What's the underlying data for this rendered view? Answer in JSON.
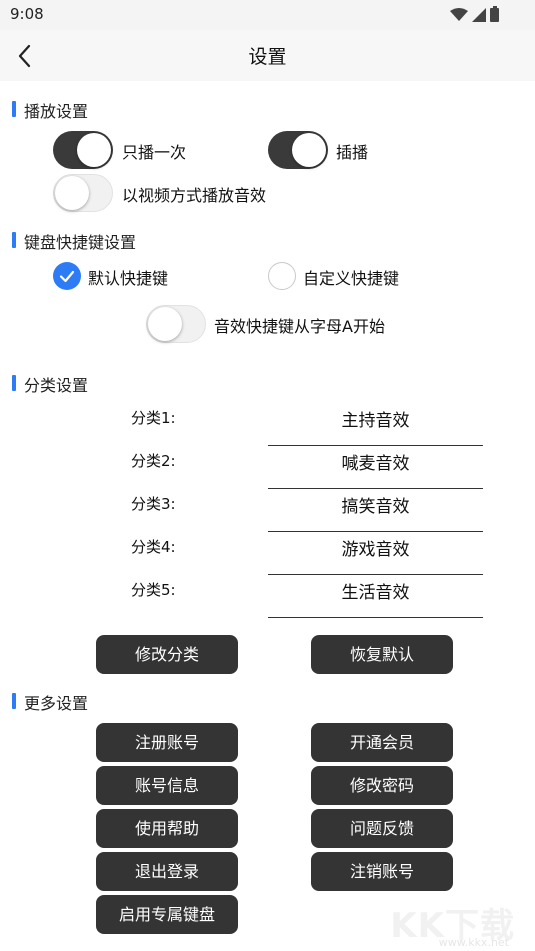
{
  "status": {
    "time": "9:08"
  },
  "header": {
    "title": "设置"
  },
  "sections": {
    "playback": "播放设置",
    "keyboard": "键盘快捷键设置",
    "category": "分类设置",
    "more": "更多设置"
  },
  "playback": {
    "play_once": {
      "label": "只播一次",
      "on": true
    },
    "insert_play": {
      "label": "插播",
      "on": true
    },
    "video_mode": {
      "label": "以视频方式播放音效",
      "on": false
    }
  },
  "keyboard": {
    "default_shortcut": {
      "label": "默认快捷键",
      "checked": true
    },
    "custom_shortcut": {
      "label": "自定义快捷键",
      "checked": false
    },
    "start_from_a": {
      "label": "音效快捷键从字母A开始",
      "on": false
    }
  },
  "categories": [
    {
      "label": "分类1:",
      "value": "主持音效"
    },
    {
      "label": "分类2:",
      "value": "喊麦音效"
    },
    {
      "label": "分类3:",
      "value": "搞笑音效"
    },
    {
      "label": "分类4:",
      "value": "游戏音效"
    },
    {
      "label": "分类5:",
      "value": "生活音效"
    }
  ],
  "category_buttons": {
    "modify": "修改分类",
    "reset": "恢复默认"
  },
  "more_buttons": {
    "register": "注册账号",
    "vip": "开通会员",
    "account_info": "账号信息",
    "change_password": "修改密码",
    "help": "使用帮助",
    "feedback": "问题反馈",
    "logout": "退出登录",
    "delete_account": "注销账号",
    "exclusive_keyboard": "启用专属键盘"
  },
  "watermark": {
    "logo": "KK下载",
    "url": "www.kkx.net"
  },
  "colors": {
    "accent": "#2d7cf6",
    "button": "#343434",
    "toggle_on": "#3a3a3a"
  }
}
